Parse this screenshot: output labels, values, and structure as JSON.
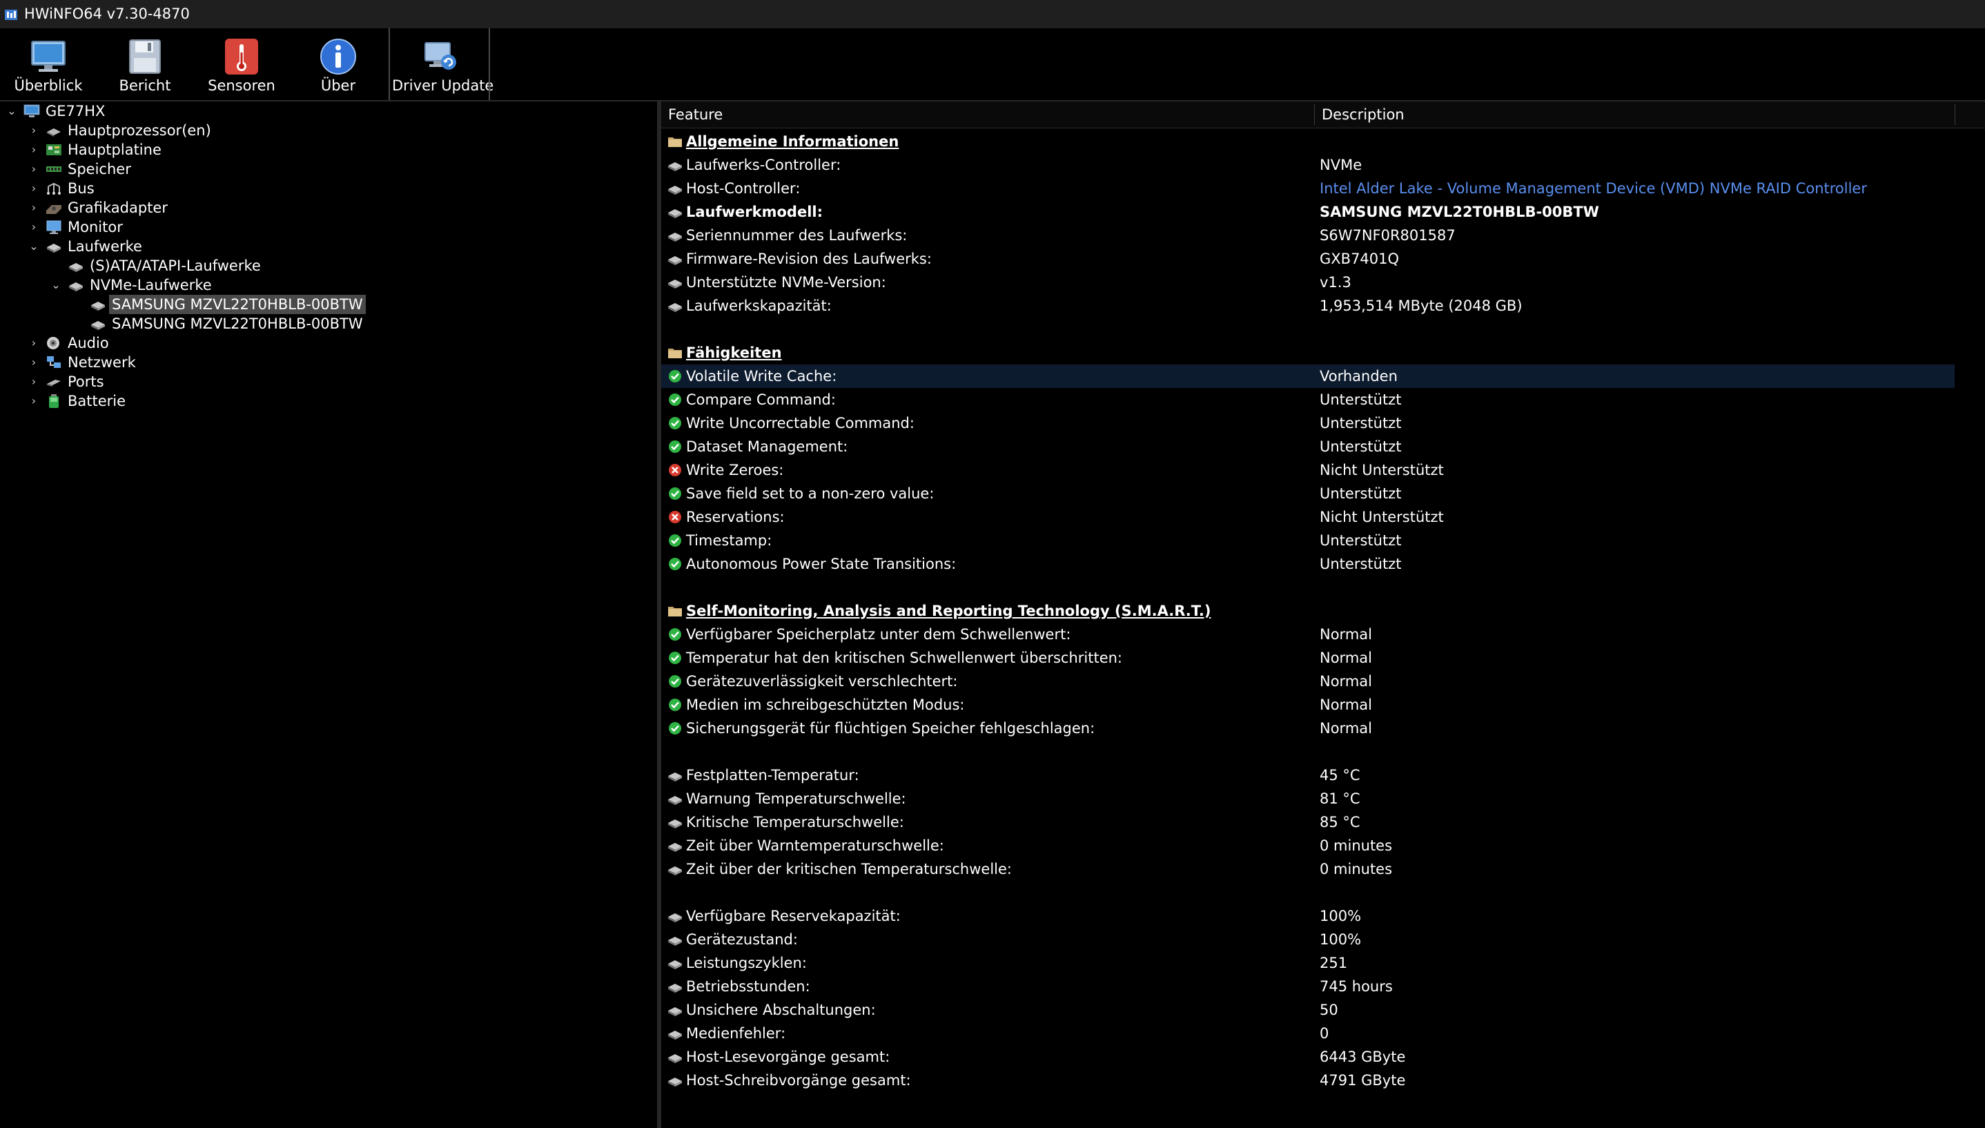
{
  "window": {
    "title": "HWiNFO64 v7.30-4870"
  },
  "toolbar": [
    {
      "label": "Überblick",
      "icon": "monitor-icon"
    },
    {
      "label": "Bericht",
      "icon": "floppy-disk-icon"
    },
    {
      "label": "Sensoren",
      "icon": "thermometer-icon"
    },
    {
      "label": "Über",
      "icon": "info-icon"
    },
    {
      "label": "Driver Update",
      "icon": "driver-update-icon"
    }
  ],
  "tree": [
    {
      "label": "GE77HX",
      "icon": "computer-icon",
      "expanded": true
    },
    {
      "label": "Hauptprozessor(en)",
      "icon": "cpu-icon",
      "expanded": false
    },
    {
      "label": "Hauptplatine",
      "icon": "motherboard-icon",
      "expanded": false
    },
    {
      "label": "Speicher",
      "icon": "memory-icon",
      "expanded": false
    },
    {
      "label": "Bus",
      "icon": "bus-icon",
      "expanded": false
    },
    {
      "label": "Grafikadapter",
      "icon": "graphics-card-icon",
      "expanded": false
    },
    {
      "label": "Monitor",
      "icon": "monitor-icon",
      "expanded": false
    },
    {
      "label": "Laufwerke",
      "icon": "drive-icon",
      "expanded": true
    },
    {
      "label": "(S)ATA/ATAPI-Laufwerke",
      "icon": "drive-icon"
    },
    {
      "label": "NVMe-Laufwerke",
      "icon": "drive-icon",
      "expanded": true
    },
    {
      "label": "SAMSUNG MZVL22T0HBLB-00BTW",
      "icon": "drive-icon",
      "selected": true
    },
    {
      "label": "SAMSUNG MZVL22T0HBLB-00BTW",
      "icon": "drive-icon"
    },
    {
      "label": "Audio",
      "icon": "speaker-icon",
      "expanded": false
    },
    {
      "label": "Netzwerk",
      "icon": "network-icon",
      "expanded": false
    },
    {
      "label": "Ports",
      "icon": "port-icon",
      "expanded": false
    },
    {
      "label": "Batterie",
      "icon": "battery-icon",
      "expanded": false
    }
  ],
  "detail": {
    "columns": {
      "feature": "Feature",
      "description": "Description"
    },
    "rows": [
      {
        "type": "section",
        "feature": "Allgemeine Informationen",
        "description": "",
        "icon": "folder-icon"
      },
      {
        "type": "item",
        "feature": "Laufwerks-Controller:",
        "description": "NVMe",
        "icon": "drive-icon"
      },
      {
        "type": "item",
        "feature": "Host-Controller:",
        "description": "Intel Alder Lake - Volume Management Device (VMD) NVMe RAID Controller",
        "icon": "drive-icon",
        "link": true
      },
      {
        "type": "item",
        "feature": "Laufwerkmodell:",
        "description": "SAMSUNG MZVL22T0HBLB-00BTW",
        "icon": "drive-icon",
        "bold": true
      },
      {
        "type": "item",
        "feature": "Seriennummer des Laufwerks:",
        "description": "S6W7NF0R801587",
        "icon": "drive-icon"
      },
      {
        "type": "item",
        "feature": "Firmware-Revision des Laufwerks:",
        "description": "GXB7401Q",
        "icon": "drive-icon"
      },
      {
        "type": "item",
        "feature": "Unterstützte NVMe-Version:",
        "description": "v1.3",
        "icon": "drive-icon"
      },
      {
        "type": "item",
        "feature": "Laufwerkskapazität:",
        "description": "1,953,514 MByte (2048 GB)",
        "icon": "drive-icon"
      },
      {
        "type": "blank",
        "feature": "",
        "description": ""
      },
      {
        "type": "section",
        "feature": "Fähigkeiten",
        "description": "",
        "icon": "folder-icon"
      },
      {
        "type": "item",
        "feature": "Volatile Write Cache:",
        "description": "Vorhanden",
        "icon": "check-icon",
        "highlighted": true
      },
      {
        "type": "item",
        "feature": "Compare Command:",
        "description": "Unterstützt",
        "icon": "check-icon"
      },
      {
        "type": "item",
        "feature": "Write Uncorrectable Command:",
        "description": "Unterstützt",
        "icon": "check-icon"
      },
      {
        "type": "item",
        "feature": "Dataset Management:",
        "description": "Unterstützt",
        "icon": "check-icon"
      },
      {
        "type": "item",
        "feature": "Write Zeroes:",
        "description": "Nicht Unterstützt",
        "icon": "cross-icon"
      },
      {
        "type": "item",
        "feature": "Save field set to a non-zero value:",
        "description": "Unterstützt",
        "icon": "check-icon"
      },
      {
        "type": "item",
        "feature": "Reservations:",
        "description": "Nicht Unterstützt",
        "icon": "cross-icon"
      },
      {
        "type": "item",
        "feature": "Timestamp:",
        "description": "Unterstützt",
        "icon": "check-icon"
      },
      {
        "type": "item",
        "feature": "Autonomous Power State Transitions:",
        "description": "Unterstützt",
        "icon": "check-icon"
      },
      {
        "type": "blank",
        "feature": "",
        "description": ""
      },
      {
        "type": "section",
        "feature": "Self-Monitoring, Analysis and Reporting Technology (S.M.A.R.T.)",
        "description": "",
        "icon": "folder-icon"
      },
      {
        "type": "item",
        "feature": "Verfügbarer Speicherplatz unter dem Schwellenwert:",
        "description": "Normal",
        "icon": "check-icon"
      },
      {
        "type": "item",
        "feature": "Temperatur hat den kritischen Schwellenwert überschritten:",
        "description": "Normal",
        "icon": "check-icon"
      },
      {
        "type": "item",
        "feature": "Gerätezuverlässigkeit verschlechtert:",
        "description": "Normal",
        "icon": "check-icon"
      },
      {
        "type": "item",
        "feature": "Medien im schreibgeschützten Modus:",
        "description": "Normal",
        "icon": "check-icon"
      },
      {
        "type": "item",
        "feature": "Sicherungsgerät für flüchtigen Speicher fehlgeschlagen:",
        "description": "Normal",
        "icon": "check-icon"
      },
      {
        "type": "blank",
        "feature": "",
        "description": ""
      },
      {
        "type": "item",
        "feature": "Festplatten-Temperatur:",
        "description": "45 °C",
        "icon": "drive-icon"
      },
      {
        "type": "item",
        "feature": "Warnung Temperaturschwelle:",
        "description": "81 °C",
        "icon": "drive-icon"
      },
      {
        "type": "item",
        "feature": "Kritische Temperaturschwelle:",
        "description": "85 °C",
        "icon": "drive-icon"
      },
      {
        "type": "item",
        "feature": "Zeit über Warntemperaturschwelle:",
        "description": "0 minutes",
        "icon": "drive-icon"
      },
      {
        "type": "item",
        "feature": "Zeit über der kritischen Temperaturschwelle:",
        "description": "0 minutes",
        "icon": "drive-icon"
      },
      {
        "type": "blank",
        "feature": "",
        "description": ""
      },
      {
        "type": "item",
        "feature": "Verfügbare Reservekapazität:",
        "description": "100%",
        "icon": "drive-icon"
      },
      {
        "type": "item",
        "feature": "Gerätezustand:",
        "description": "100%",
        "icon": "drive-icon"
      },
      {
        "type": "item",
        "feature": "Leistungszyklen:",
        "description": "251",
        "icon": "drive-icon"
      },
      {
        "type": "item",
        "feature": "Betriebsstunden:",
        "description": "745 hours",
        "icon": "drive-icon"
      },
      {
        "type": "item",
        "feature": "Unsichere Abschaltungen:",
        "description": "50",
        "icon": "drive-icon"
      },
      {
        "type": "item",
        "feature": "Medienfehler:",
        "description": "0",
        "icon": "drive-icon"
      },
      {
        "type": "item",
        "feature": "Host-Lesevorgänge gesamt:",
        "description": "6443 GByte",
        "icon": "drive-icon"
      },
      {
        "type": "item",
        "feature": "Host-Schreibvorgänge gesamt:",
        "description": "4791 GByte",
        "icon": "drive-icon"
      }
    ]
  },
  "colors": {
    "background": "#000000",
    "selection": "#0d1b2e",
    "link": "#5b8ff0",
    "check": "#2fb344",
    "cross": "#d83a2e"
  }
}
